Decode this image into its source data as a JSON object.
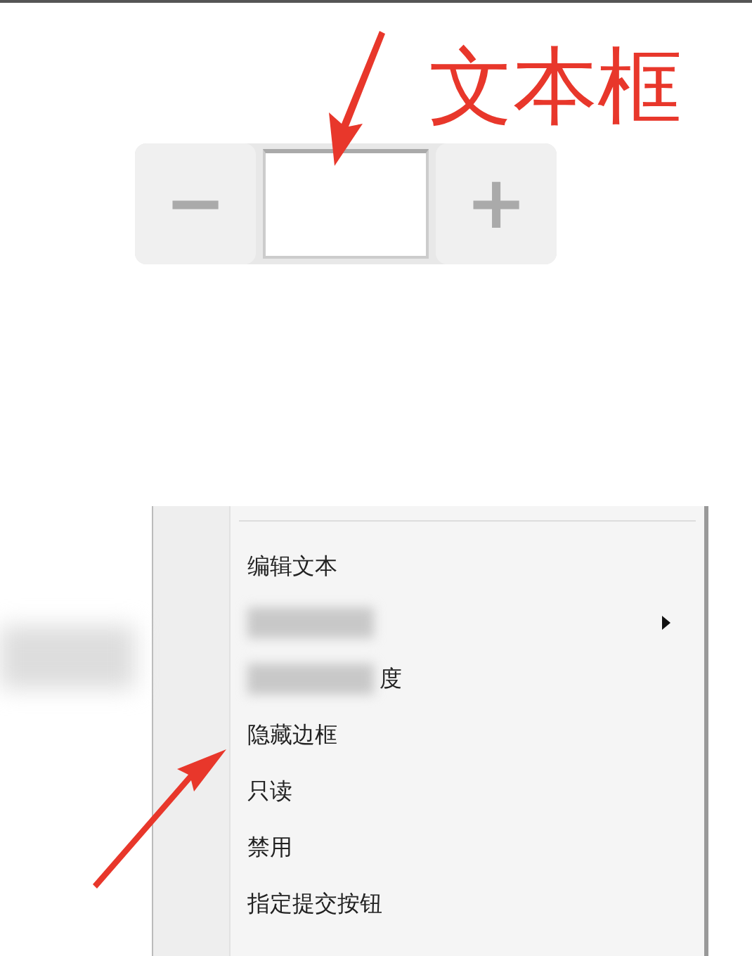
{
  "annotation": {
    "label": "文本框"
  },
  "stepper": {
    "minus": "−",
    "plus": "+"
  },
  "context_menu": {
    "items": [
      {
        "kind": "text",
        "label": "编辑文本",
        "submenu": false
      },
      {
        "kind": "blurred",
        "submenu": true
      },
      {
        "kind": "blurred",
        "label": "度",
        "submenu": false
      },
      {
        "kind": "text",
        "label": "隐藏边框",
        "submenu": false
      },
      {
        "kind": "text",
        "label": "只读",
        "submenu": false
      },
      {
        "kind": "text",
        "label": "禁用",
        "submenu": false
      },
      {
        "kind": "text",
        "label": "指定提交按钮",
        "submenu": false
      }
    ]
  }
}
